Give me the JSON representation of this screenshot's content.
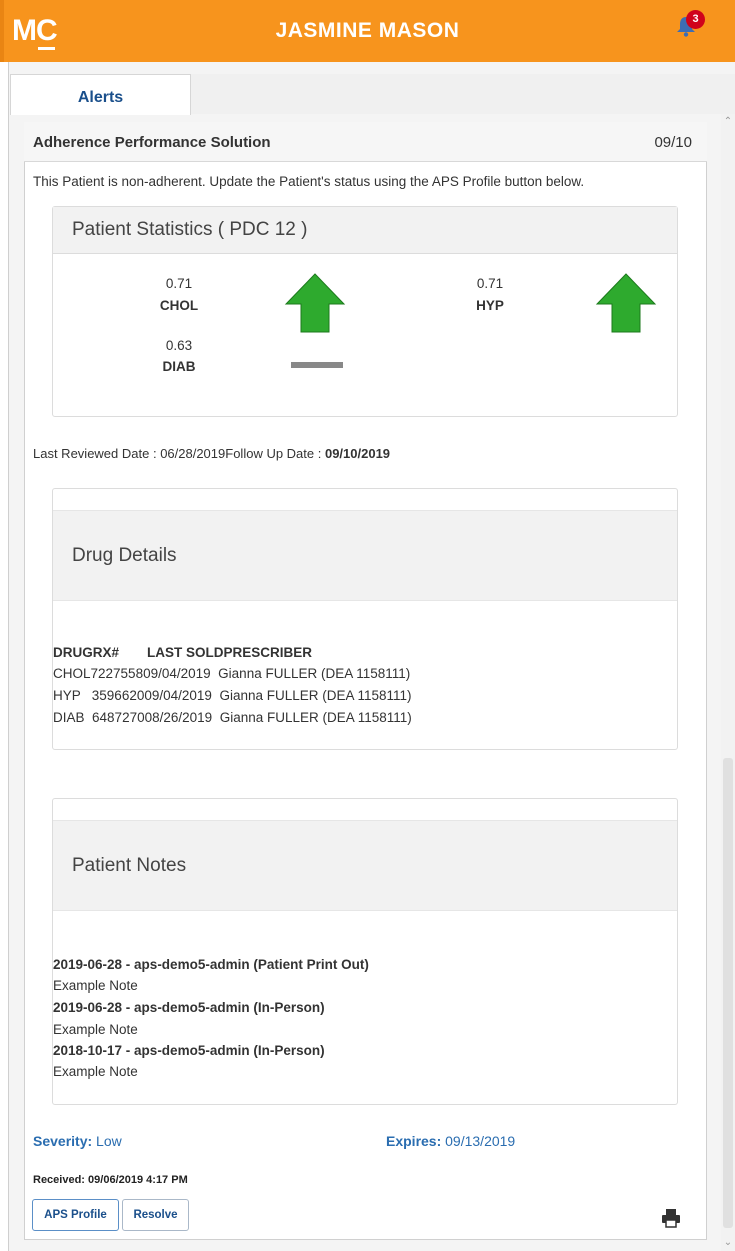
{
  "header": {
    "logo": "MC",
    "title": "JASMINE MASON",
    "notification_count": "3"
  },
  "tabs": [
    {
      "label": "Alerts"
    }
  ],
  "alert": {
    "title": "Adherence Performance Solution",
    "date": "09/10",
    "message": "This Patient is non-adherent. Update the Patient's status using the APS Profile button below."
  },
  "stats": {
    "title": "Patient Statistics ( PDC 12 )",
    "items": [
      {
        "value": "0.71",
        "label": "CHOL",
        "trend": "up"
      },
      {
        "value": "0.71",
        "label": "HYP",
        "trend": "up"
      },
      {
        "value": "0.63",
        "label": "DIAB",
        "trend": "flat"
      }
    ]
  },
  "review": {
    "last_reviewed_label": "Last Reviewed Date : ",
    "last_reviewed": "06/28/2019",
    "follow_up_label": "Follow Up Date : ",
    "follow_up": "09/10/2019"
  },
  "drugs": {
    "title": "Drug Details",
    "headers": {
      "drug": "DRUG",
      "rx": "RX#",
      "last_sold": "LAST SOLD",
      "prescriber": "PRESCRIBER"
    },
    "rows": [
      {
        "drug": "CHOL",
        "rx": "7227558",
        "last_sold": "09/04/2019",
        "prescriber": "Gianna FULLER (DEA 1158111)"
      },
      {
        "drug": "HYP",
        "rx": "3596620",
        "last_sold": "09/04/2019",
        "prescriber": "Gianna FULLER (DEA 1158111)"
      },
      {
        "drug": "DIAB",
        "rx": "6487270",
        "last_sold": "08/26/2019",
        "prescriber": "Gianna FULLER (DEA 1158111)"
      }
    ]
  },
  "notes": {
    "title": "Patient Notes",
    "items": [
      {
        "header": "2019-06-28 - aps-demo5-admin (Patient Print Out)",
        "body": "Example Note"
      },
      {
        "header": "2019-06-28 - aps-demo5-admin (In-Person)",
        "body": "Example Note"
      },
      {
        "header": "2018-10-17 - aps-demo5-admin (In-Person)",
        "body": "Example Note"
      }
    ]
  },
  "footer": {
    "severity_label": "Severity:",
    "severity": "Low",
    "expires_label": "Expires:",
    "expires": "09/13/2019",
    "received_label": "Received:",
    "received": "09/06/2019 4:17 PM",
    "aps_profile_button": "APS Profile",
    "resolve_button": "Resolve"
  },
  "icons": {
    "notification": "bell-icon",
    "print": "printer-icon",
    "trend_up": "up-arrow-icon",
    "trend_flat": "flat-line-icon"
  },
  "colors": {
    "brand": "#f7941d",
    "link": "#1a4f8b",
    "badge": "#d0021b",
    "arrow": "#2eaa2e"
  }
}
